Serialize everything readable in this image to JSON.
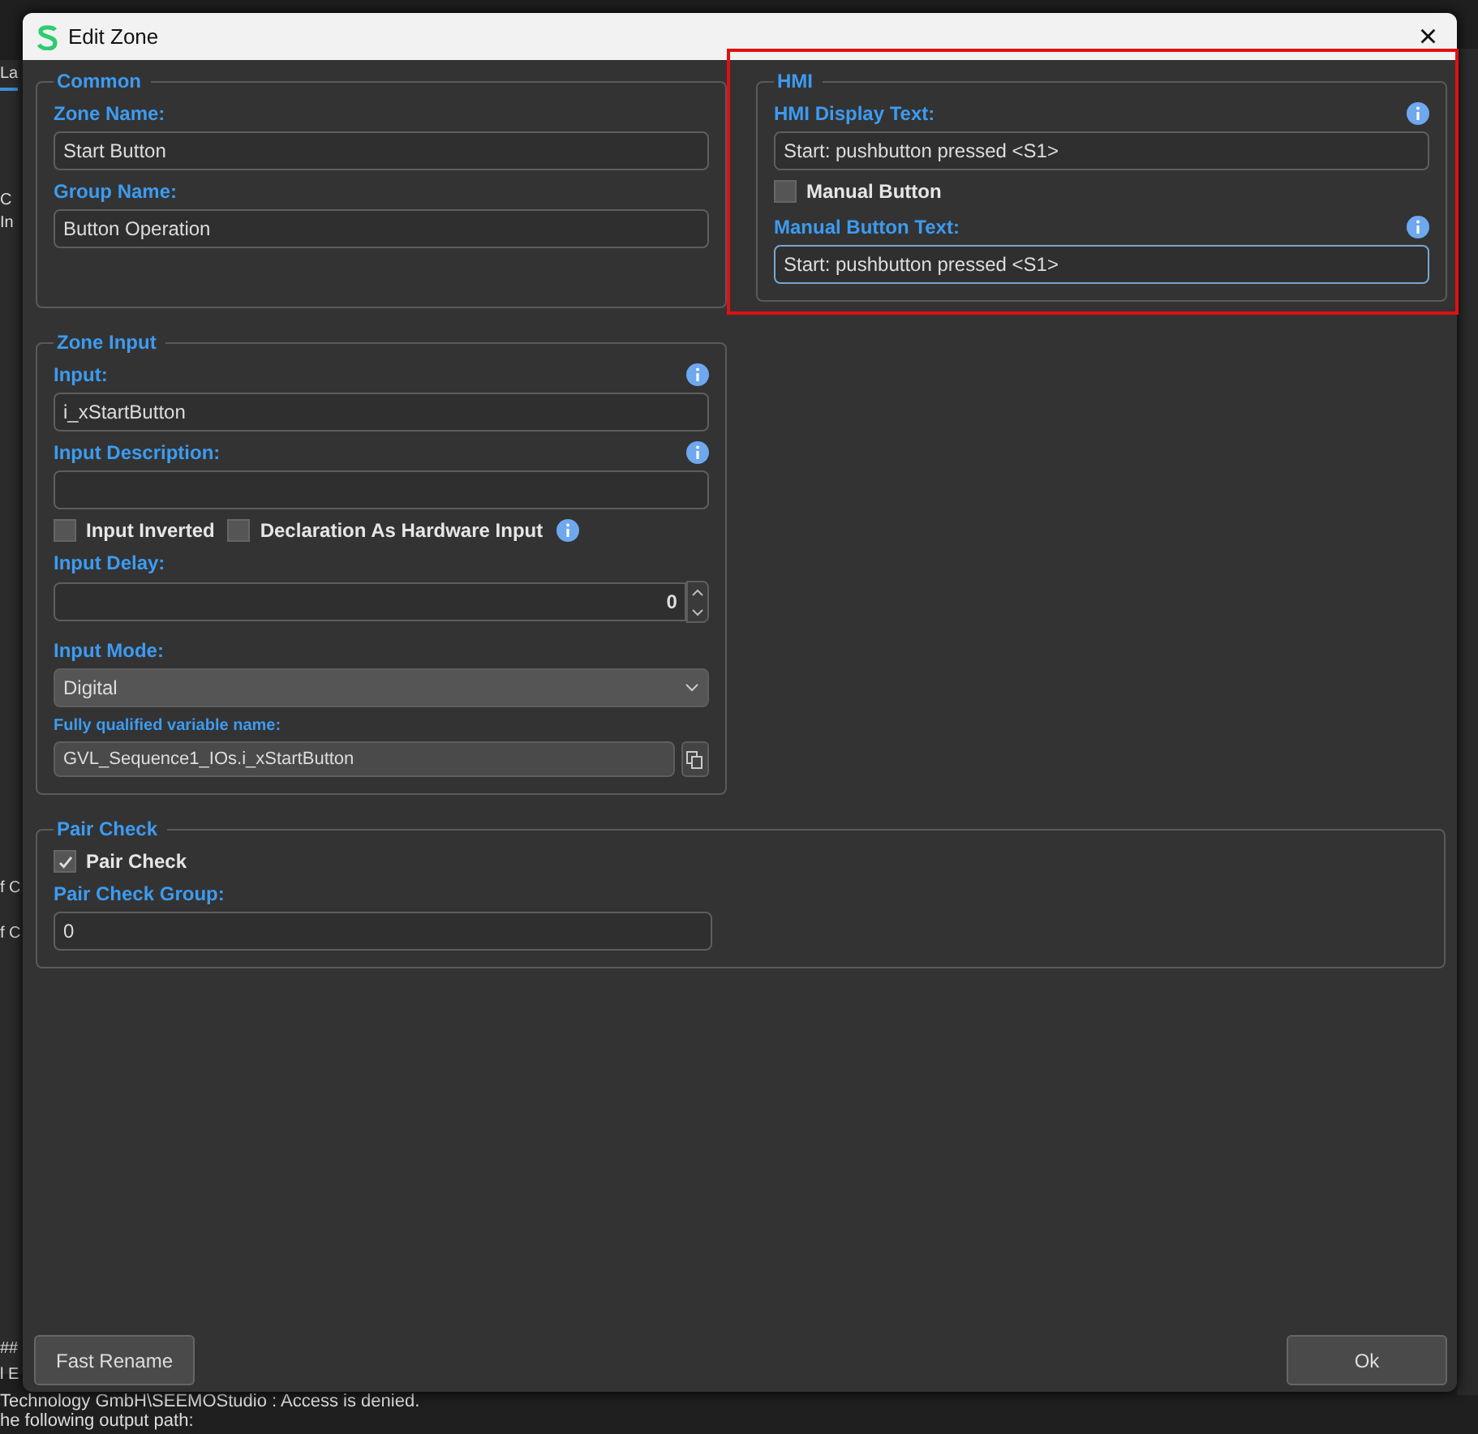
{
  "background_app": {
    "tab": "La",
    "side_texts": [
      "C",
      "In",
      "f C",
      "f C"
    ],
    "output_left": [
      "##",
      "l E"
    ],
    "output_lines": [
      "Technology GmbH\\SEEMOStudio : Access is denied.",
      "he following output path:"
    ]
  },
  "window": {
    "title": "Edit Zone",
    "close": "×"
  },
  "common": {
    "title": "Common",
    "fields": [
      {
        "label": "Zone Name:",
        "value": "Start Button"
      },
      {
        "label": "Group Name:",
        "value": "Button Operation"
      }
    ]
  },
  "hmi": {
    "title": "HMI",
    "display_text": {
      "label": "HMI Display Text:",
      "value": "Start: pushbutton pressed <S1>",
      "info": true
    },
    "manual_button": {
      "label": "Manual Button",
      "checked": false
    },
    "manual_text": {
      "label": "Manual Button Text:",
      "value": "Start: pushbutton pressed <S1>",
      "info": true,
      "focused": true
    }
  },
  "zone_input": {
    "title": "Zone Input",
    "input": {
      "label": "Input:",
      "value": "i_xStartButton",
      "info": true
    },
    "description": {
      "label": "Input Description:",
      "info": true
    },
    "checks": [
      {
        "label": "Input Inverted",
        "checked": false,
        "info": false
      },
      {
        "label": "Declaration As Hardware Input",
        "checked": false,
        "info": true
      }
    ],
    "delay": {
      "label": "Input Delay:",
      "value": "0"
    },
    "mode": {
      "label": "Input Mode:",
      "value": "Digital"
    },
    "qualified": {
      "label": "Fully qualified variable name:",
      "value": "GVL_Sequence1_IOs.i_xStartButton"
    }
  },
  "pair_check": {
    "title": "Pair Check",
    "check": {
      "label": "Pair Check",
      "checked": true
    },
    "group": {
      "label": "Pair Check Group:",
      "value": "0"
    }
  },
  "buttons": {
    "left": "Fast Rename",
    "right": "Ok"
  }
}
